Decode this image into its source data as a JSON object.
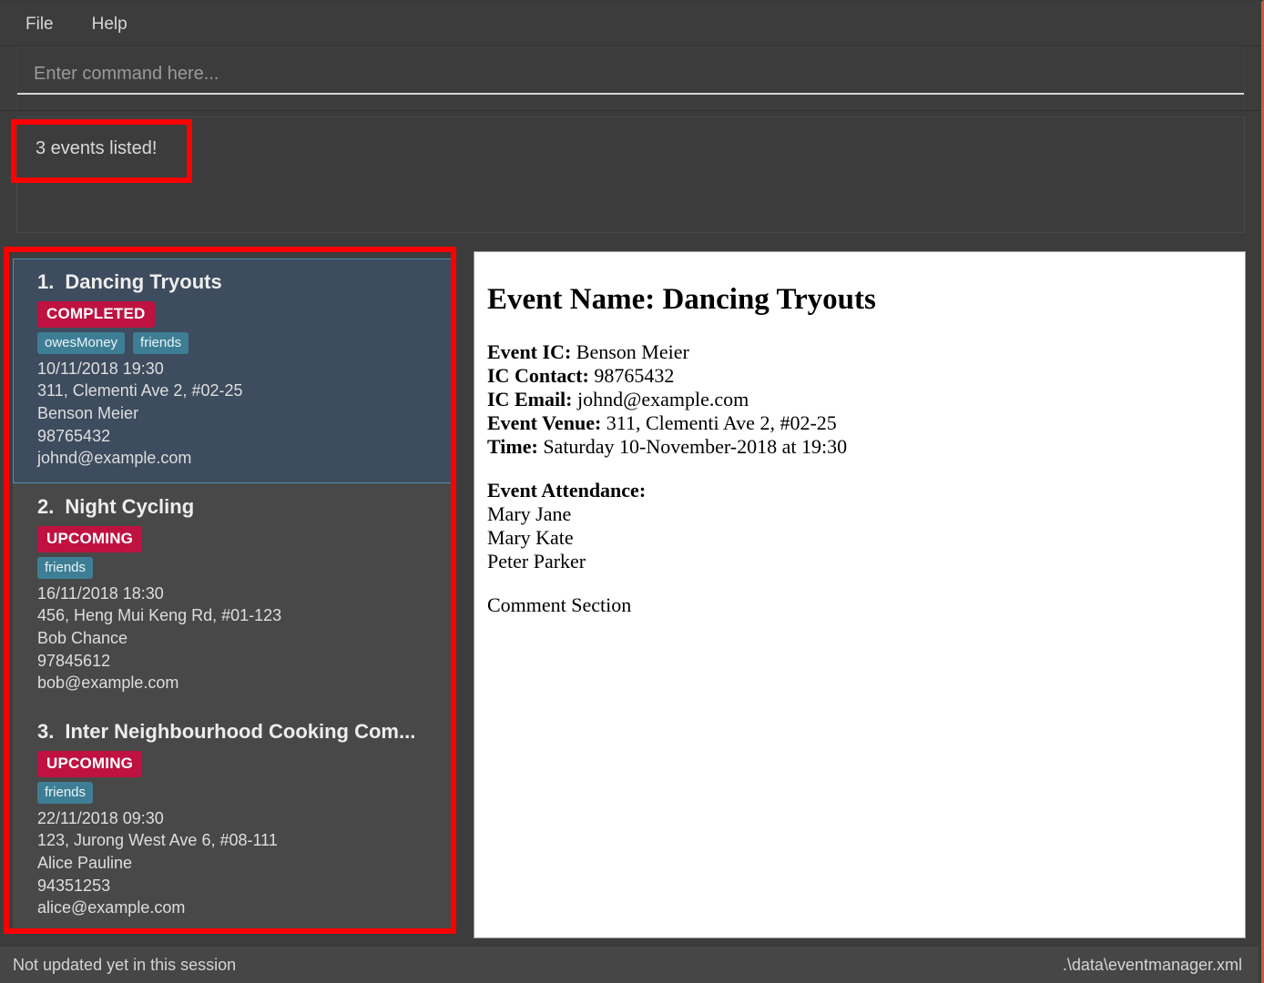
{
  "window": {
    "accent_border_color": "#C0603A",
    "background_color": "#3C3C3C"
  },
  "menubar": {
    "items": [
      {
        "label": "File",
        "name": "menu-file"
      },
      {
        "label": "Help",
        "name": "menu-help"
      }
    ]
  },
  "command": {
    "placeholder": "Enter command here...",
    "value": ""
  },
  "result": {
    "text": "3 events listed!"
  },
  "event_list": {
    "selected_index": 0,
    "items": [
      {
        "index": "1.",
        "title": "Dancing Tryouts",
        "status": "COMPLETED",
        "status_color": "#BF1240",
        "tags": [
          "owesMoney",
          "friends"
        ],
        "datetime": "10/11/2018 19:30",
        "venue": "311, Clementi Ave 2, #02-25",
        "contact_name": "Benson Meier",
        "phone": "98765432",
        "email": "johnd@example.com",
        "selected": true
      },
      {
        "index": "2.",
        "title": "Night Cycling",
        "status": "UPCOMING",
        "status_color": "#BF1240",
        "tags": [
          "friends"
        ],
        "datetime": "16/11/2018 18:30",
        "venue": "456, Heng Mui Keng Rd, #01-123",
        "contact_name": "Bob Chance",
        "phone": "97845612",
        "email": "bob@example.com",
        "selected": false
      },
      {
        "index": "3.",
        "title": "Inter Neighbourhood Cooking Com...",
        "status": "UPCOMING",
        "status_color": "#BF1240",
        "tags": [
          "friends"
        ],
        "datetime": "22/11/2018 09:30",
        "venue": "123, Jurong West Ave 6, #08-111",
        "contact_name": "Alice Pauline",
        "phone": "94351253",
        "email": "alice@example.com",
        "selected": false
      }
    ]
  },
  "detail": {
    "heading": "Event Name: Dancing Tryouts",
    "fields": [
      {
        "label": "Event IC:",
        "value": "Benson Meier"
      },
      {
        "label": "IC Contact:",
        "value": "98765432"
      },
      {
        "label": "IC Email:",
        "value": "johnd@example.com"
      },
      {
        "label": "Event Venue:",
        "value": "311, Clementi Ave 2, #02-25"
      },
      {
        "label": "Time:",
        "value": "Saturday 10-November-2018 at 19:30"
      }
    ],
    "attendance_label": "Event Attendance:",
    "attendees": [
      "Mary Jane",
      "Mary Kate",
      "Peter Parker"
    ],
    "comment_section_label": "Comment Section"
  },
  "statusbar": {
    "sync_status": "Not updated yet in this session",
    "file_path": ".\\data\\eventmanager.xml"
  },
  "annotations": {
    "highlight_color": "#FF0000",
    "boxes": [
      "result-box-highlight",
      "event-list-highlight"
    ]
  }
}
